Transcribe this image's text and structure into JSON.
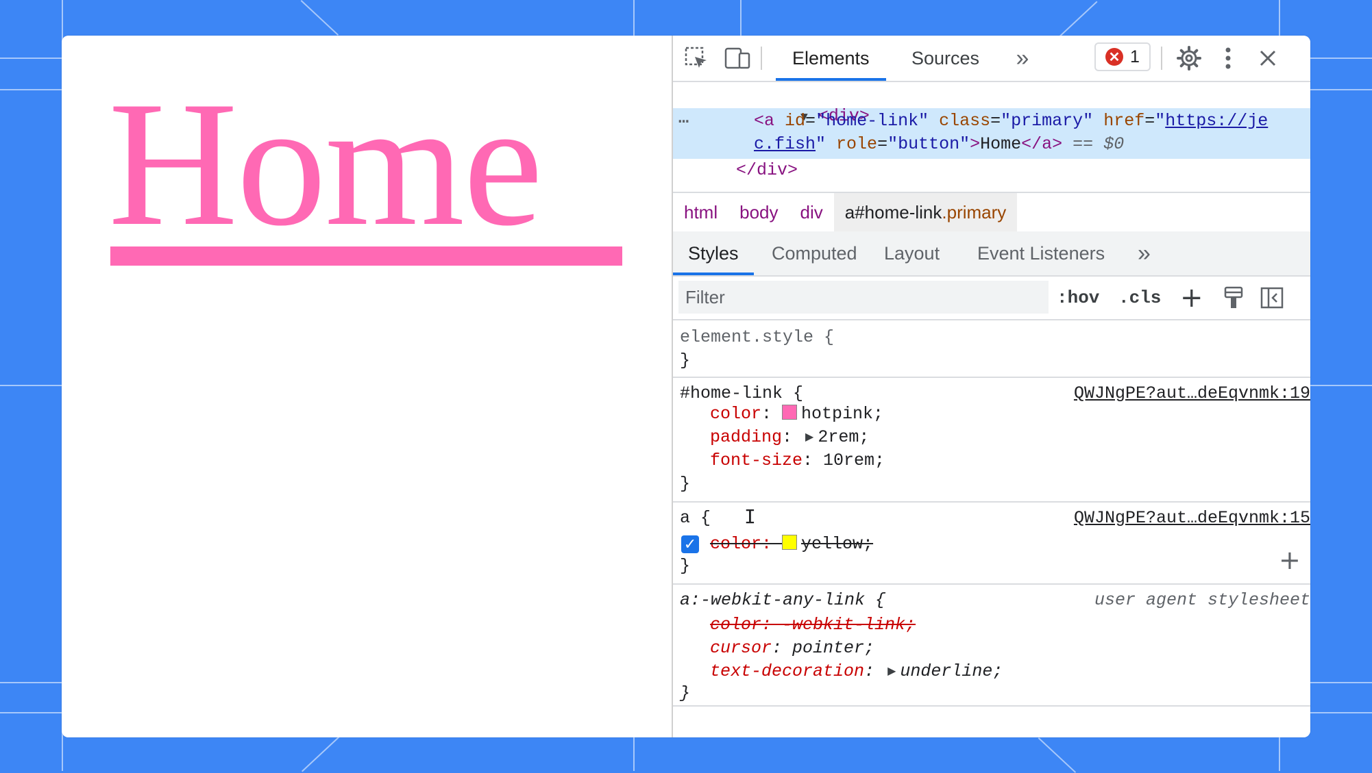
{
  "page": {
    "link_text": "Home",
    "link_color": "#ff69b4"
  },
  "devtools": {
    "toolbar": {
      "inspect_icon": "inspect-element-icon",
      "device_icon": "device-toolbar-icon",
      "tabs": [
        "Elements",
        "Sources"
      ],
      "more_tabs": "»",
      "error_count": "1",
      "settings_icon": "gear-icon",
      "menu_icon": "kebab-menu-icon",
      "close_icon": "close-icon"
    },
    "dom": {
      "open_div": "<div>",
      "ellipsis": "…",
      "a_open": "<a",
      "attr_id_name": "id",
      "attr_id_value": "\"home-link\"",
      "attr_class_name": "class",
      "attr_class_value": "\"primary\"",
      "attr_href_name": "href",
      "href_part1": "https://je",
      "href_part2": "c.fish",
      "attr_role_name": "role",
      "attr_role_value": "\"button\"",
      "a_text": "Home",
      "a_close": "</a>",
      "eq_marker": "==",
      "dollar0": "$0",
      "close_div": "</div>"
    },
    "breadcrumbs": {
      "html": "html",
      "body": "body",
      "div": "div",
      "a_tag": "a#home-link",
      "a_class": ".primary"
    },
    "subtabs": [
      "Styles",
      "Computed",
      "Layout",
      "Event Listeners"
    ],
    "subtabs_more": "»",
    "filter": {
      "placeholder": "Filter",
      "hov": ":hov",
      "cls": ".cls",
      "plus": "+"
    },
    "rules": {
      "element_style": {
        "selector": "element.style {",
        "close": "}"
      },
      "home_link": {
        "selector": "#home-link {",
        "source": "QWJNgPE?aut…deEqvnmk:19",
        "color_prop": "color",
        "color_value": "hotpink;",
        "color_swatch": "#ff69b4",
        "padding_prop": "padding",
        "padding_value": "2rem;",
        "font_size_prop": "font-size",
        "font_size_value": "10rem;",
        "close": "}"
      },
      "a_rule": {
        "selector": "a {",
        "source": "QWJNgPE?aut…deEqvnmk:15",
        "color_prop": "color:",
        "color_value": "yellow;",
        "color_swatch": "#ffff00",
        "close": "}",
        "add": "+"
      },
      "ua_rule": {
        "selector": "a:-webkit-any-link {",
        "source": "user agent stylesheet",
        "color_line": "color: -webkit-link;",
        "cursor_prop": "cursor",
        "cursor_value": "pointer;",
        "td_prop": "text-decoration",
        "td_value": "underline;",
        "close": "}"
      }
    }
  }
}
